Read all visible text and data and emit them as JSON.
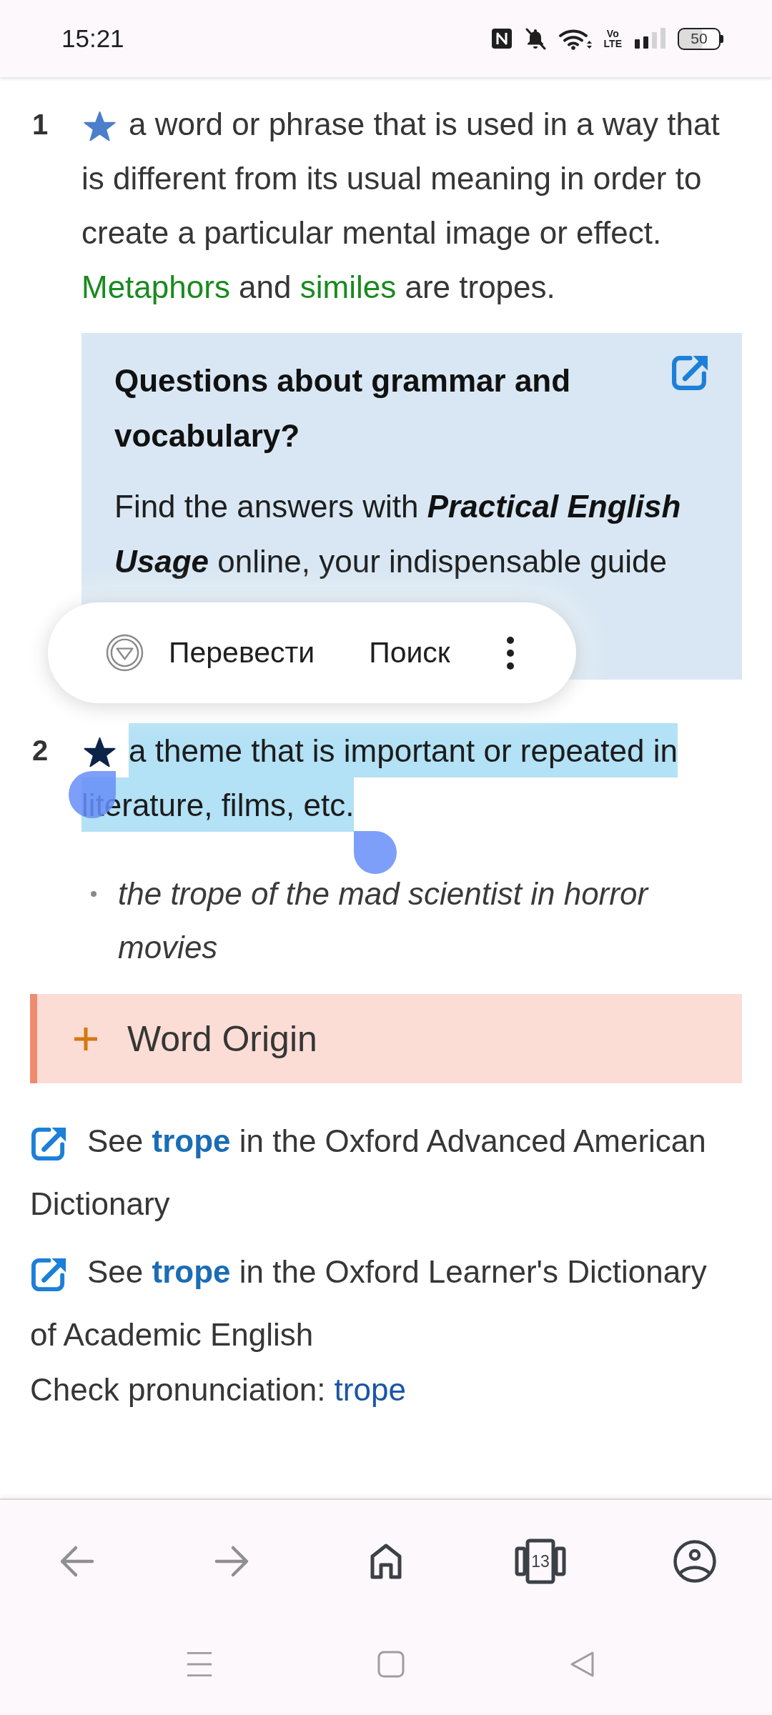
{
  "status_bar": {
    "time": "15:21",
    "icons": [
      {
        "kind": "nfc"
      },
      {
        "kind": "bell_off"
      },
      {
        "kind": "wifi"
      },
      {
        "kind": "volte",
        "lines": [
          "Vo",
          "LTE"
        ]
      },
      {
        "kind": "signal"
      },
      {
        "kind": "battery",
        "text": "50"
      }
    ]
  },
  "senses": [
    {
      "number": "1",
      "color": "#4b7fcb",
      "selected": false,
      "definition": [
        {
          "kind": "text",
          "text": "a word or phrase that is used in a way that is different from its usual meaning in order to create a particular mental image or effect. "
        },
        {
          "kind": "link",
          "text": "Metaphors"
        },
        {
          "kind": "text",
          "text": " and "
        },
        {
          "kind": "link",
          "text": "similes"
        },
        {
          "kind": "text",
          "text": " are tropes."
        }
      ],
      "info_box": {
        "title": "Questions about grammar and vocabulary?",
        "text": "Find the answers with **Practical English Usage** online, your indispensable guide"
      }
    },
    {
      "number": "2",
      "color": "#0c2448",
      "selected": true,
      "definition": [
        {
          "kind": "text",
          "text": "a theme that is important or repeated in literature, films, etc."
        }
      ],
      "examples": [
        "the trope of the mad scientist in horror movies"
      ]
    }
  ],
  "selection_menu": {
    "items": [
      {
        "kind": "translate",
        "label": "Перевести"
      },
      {
        "kind": "search",
        "label": "Поиск"
      }
    ]
  },
  "word_origin": {
    "label": "Word Origin",
    "expanded": false
  },
  "see_also": [
    {
      "before": "See ",
      "link": "trope",
      "after": " in the Oxford Advanced American Dictionary"
    },
    {
      "before": "See ",
      "link": "trope",
      "after": " in the Oxford Learner's Dictionary of Academic English"
    }
  ],
  "pronunciation": {
    "label": "Check pronunciation: ",
    "link": "trope"
  },
  "toolbar": [
    {
      "kind": "back",
      "disabled": true
    },
    {
      "kind": "forward",
      "disabled": true
    },
    {
      "kind": "home",
      "disabled": false
    },
    {
      "kind": "tabs",
      "count": "13",
      "disabled": false
    },
    {
      "kind": "account",
      "disabled": false
    }
  ],
  "system_nav": [
    {
      "kind": "recents"
    },
    {
      "kind": "home"
    },
    {
      "kind": "back"
    }
  ]
}
